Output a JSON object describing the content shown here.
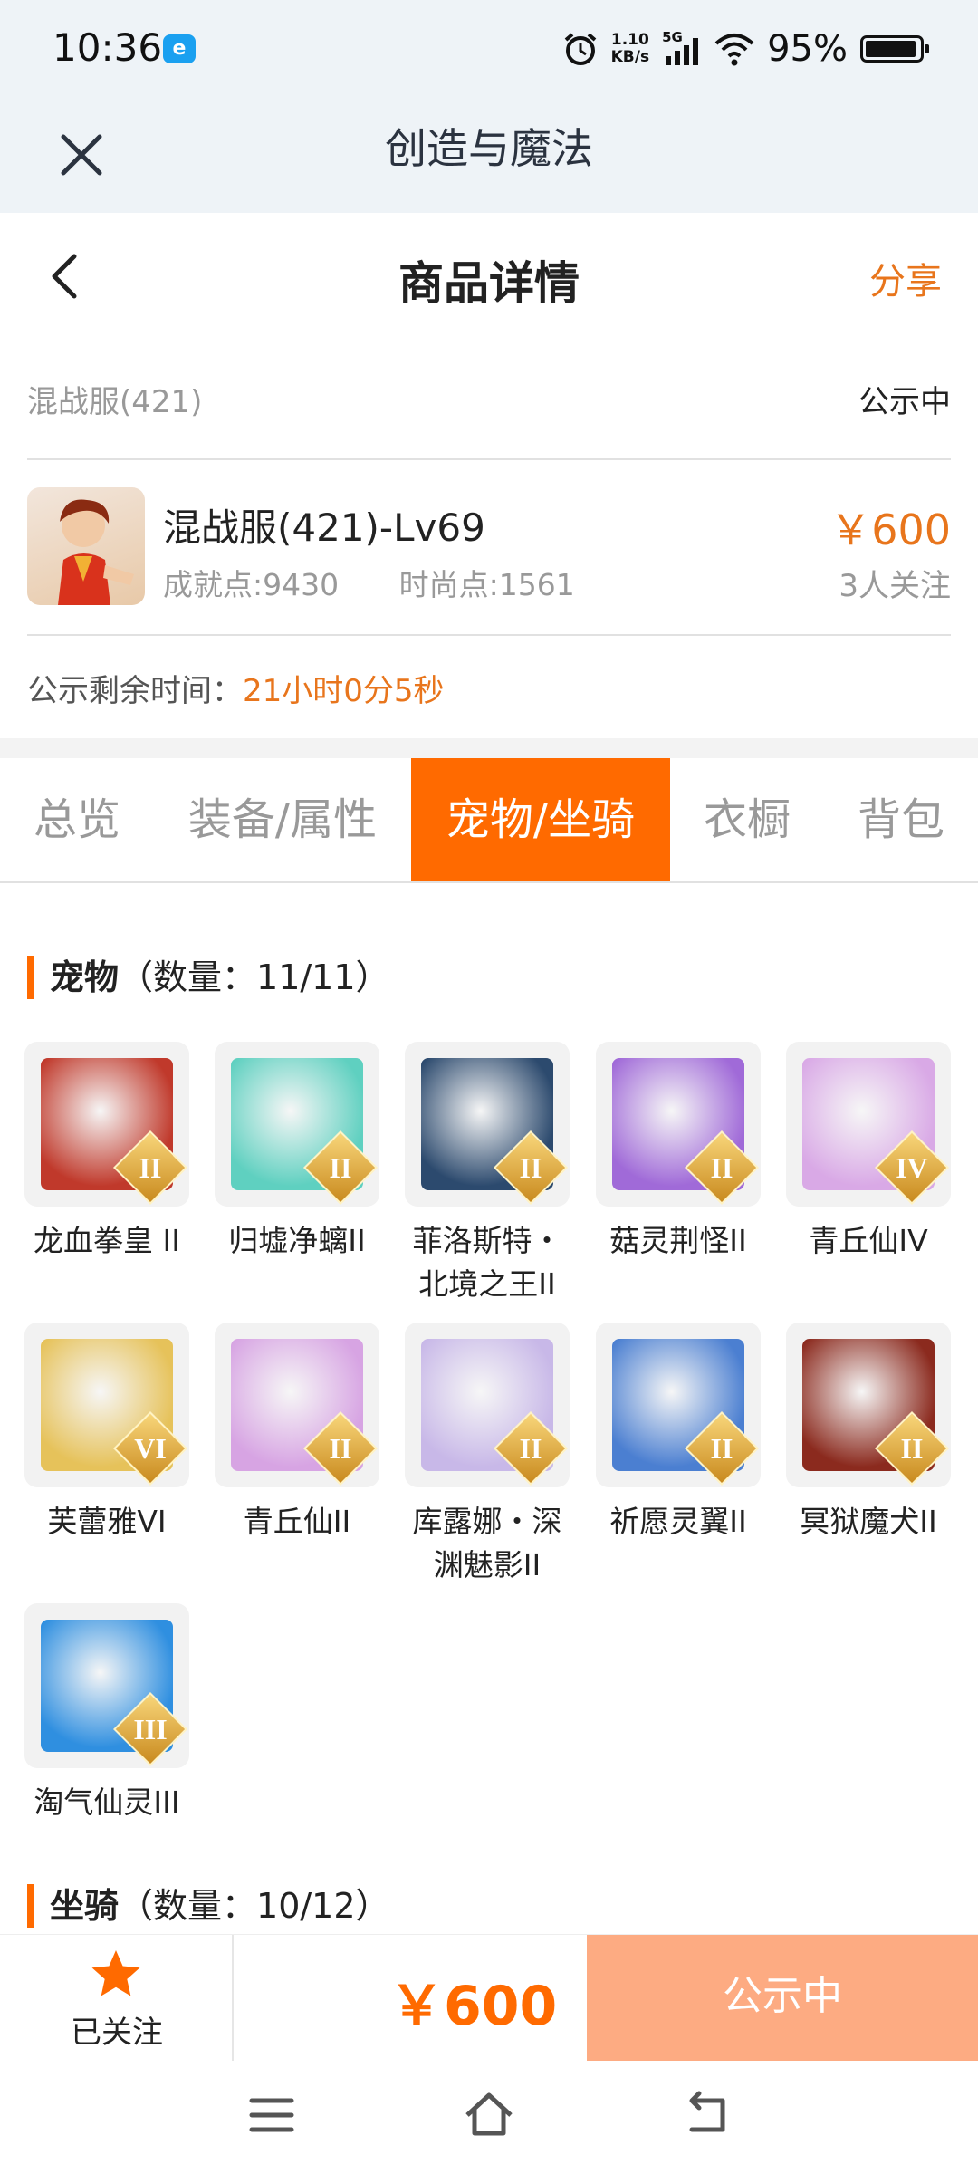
{
  "status_bar": {
    "time": "10:36",
    "speed_value": "1.10",
    "speed_unit": "KB/s",
    "network": "5G",
    "battery": "95%",
    "battery_level": 0.95
  },
  "webview": {
    "title": "创造与魔法"
  },
  "header": {
    "title": "商品详情",
    "share_label": "分享"
  },
  "product": {
    "server": "混战服(421)",
    "status": "公示中",
    "name": "混战服(421)-Lv69",
    "achievement_points": "成就点:9430",
    "fashion_points": "时尚点:1561",
    "price": "￥600",
    "followers": "3人关注",
    "countdown_label": "公示剩余时间：",
    "countdown_value": "21小时0分5秒"
  },
  "tabs": [
    {
      "label": "总览",
      "active": false
    },
    {
      "label": "装备/属性",
      "active": false
    },
    {
      "label": "宠物/坐骑",
      "active": true
    },
    {
      "label": "衣橱",
      "active": false
    },
    {
      "label": "背包",
      "active": false
    }
  ],
  "pets_section": {
    "title": "宠物",
    "count": "（数量：11/11）",
    "items": [
      {
        "name": "龙血拳皇 II",
        "rank": "II",
        "color": "#c0392b"
      },
      {
        "name": "归墟净螭II",
        "rank": "II",
        "color": "#5fd0c0"
      },
      {
        "name": "菲洛斯特・北境之王II",
        "rank": "II",
        "color": "#2c4a6e"
      },
      {
        "name": "菇灵荆怪II",
        "rank": "II",
        "color": "#a06ad8"
      },
      {
        "name": "青丘仙IV",
        "rank": "IV",
        "color": "#d9a9e6"
      },
      {
        "name": "芙蕾雅VI",
        "rank": "VI",
        "color": "#e6c25a"
      },
      {
        "name": "青丘仙II",
        "rank": "II",
        "color": "#d7a4e3"
      },
      {
        "name": "库露娜・深渊魅影II",
        "rank": "II",
        "color": "#c8b8e8"
      },
      {
        "name": "祈愿灵翼II",
        "rank": "II",
        "color": "#4b7fd1"
      },
      {
        "name": "冥狱魔犬II",
        "rank": "II",
        "color": "#8b2a1e"
      },
      {
        "name": "淘气仙灵III",
        "rank": "III",
        "color": "#2f8fe0"
      }
    ]
  },
  "mounts_section": {
    "title": "坐骑",
    "count": "（数量：10/12）"
  },
  "bottom_bar": {
    "follow_label": "已关注",
    "price": "￥600",
    "status_button": "公示中"
  },
  "colors": {
    "accent": "#ff6a00",
    "price": "#e8751c",
    "disabled_button": "#fdab82"
  }
}
